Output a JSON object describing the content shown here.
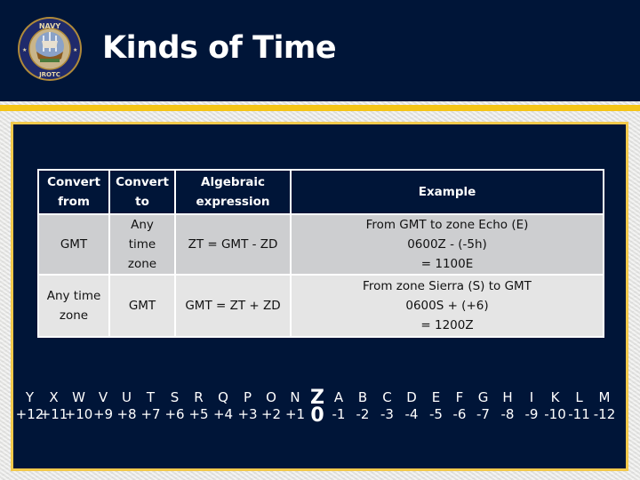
{
  "slide": {
    "title": "Kinds of Time",
    "logo": {
      "icon": "navy-jrotc-emblem-icon",
      "top_text": "NAVY",
      "bottom_text": "JROTC"
    }
  },
  "colors": {
    "navy": "#001538",
    "gold": "#f5c518",
    "frame": "#e9e9e7",
    "row1": "#cdced0",
    "row2": "#e5e5e5"
  },
  "table": {
    "headers": [
      "Convert from",
      "Convert to",
      "Algebraic expression",
      "Example"
    ],
    "rows": [
      {
        "from": "GMT",
        "to": "Any time zone",
        "expression": "ZT = GMT - ZD",
        "example": [
          "From GMT to zone Echo (E)",
          "0600Z - (-5h)",
          "= 1100E"
        ]
      },
      {
        "from": "Any time zone",
        "to": "GMT",
        "expression": "GMT = ZT + ZD",
        "example": [
          "From zone Sierra (S) to GMT",
          "0600S + (+6)",
          "= 1200Z"
        ]
      }
    ]
  },
  "zones": [
    {
      "letter": "Y",
      "offset": "+12"
    },
    {
      "letter": "X",
      "offset": "+11"
    },
    {
      "letter": "W",
      "offset": "+10"
    },
    {
      "letter": "V",
      "offset": "+9"
    },
    {
      "letter": "U",
      "offset": "+8"
    },
    {
      "letter": "T",
      "offset": "+7"
    },
    {
      "letter": "S",
      "offset": "+6"
    },
    {
      "letter": "R",
      "offset": "+5"
    },
    {
      "letter": "Q",
      "offset": "+4"
    },
    {
      "letter": "P",
      "offset": "+3"
    },
    {
      "letter": "O",
      "offset": "+2"
    },
    {
      "letter": "N",
      "offset": "+1"
    },
    {
      "letter": "Z",
      "offset": "0"
    },
    {
      "letter": "A",
      "offset": "-1"
    },
    {
      "letter": "B",
      "offset": "-2"
    },
    {
      "letter": "C",
      "offset": "-3"
    },
    {
      "letter": "D",
      "offset": "-4"
    },
    {
      "letter": "E",
      "offset": "-5"
    },
    {
      "letter": "F",
      "offset": "-6"
    },
    {
      "letter": "G",
      "offset": "-7"
    },
    {
      "letter": "H",
      "offset": "-8"
    },
    {
      "letter": "I",
      "offset": "-9"
    },
    {
      "letter": "K",
      "offset": "-10"
    },
    {
      "letter": "L",
      "offset": "-11"
    },
    {
      "letter": "M",
      "offset": "-12"
    }
  ]
}
